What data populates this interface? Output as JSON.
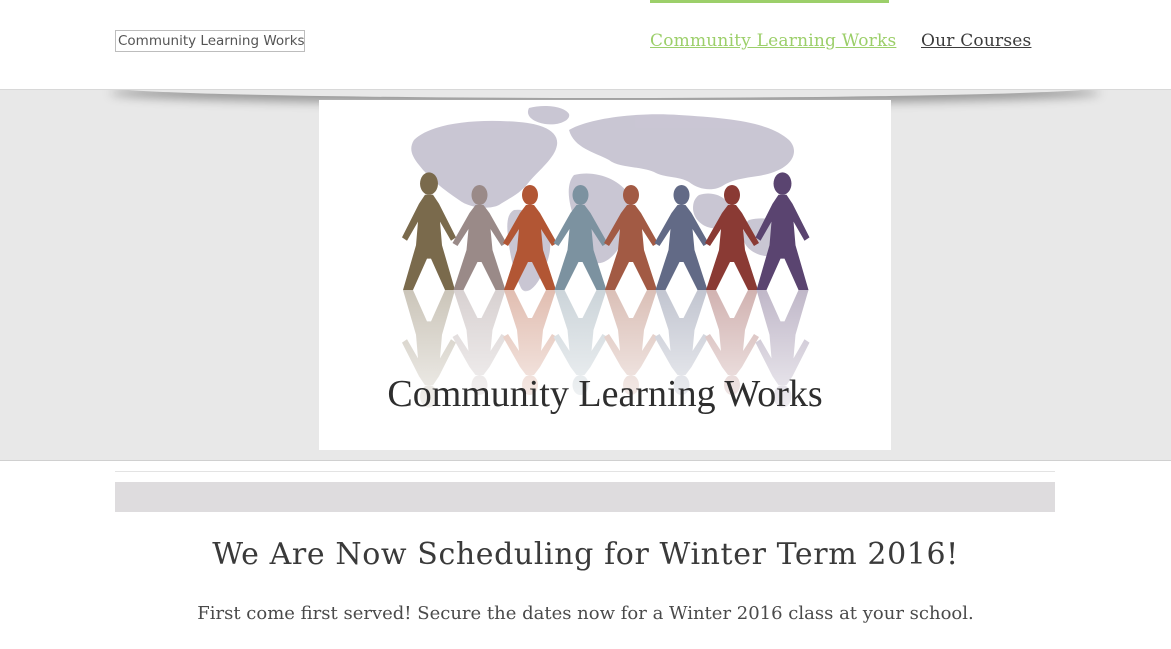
{
  "header": {
    "logo_text": "Community Learning Works",
    "nav": [
      {
        "label": "Community Learning Works",
        "active": true
      },
      {
        "label": "Our Courses",
        "active": false
      }
    ]
  },
  "banner": {
    "image_caption": "Community Learning Works",
    "figure_colors": [
      "#7a6a4c",
      "#9a8a88",
      "#b25634",
      "#7c92a0",
      "#a25a44",
      "#626a86",
      "#8a3a34",
      "#5a4470"
    ]
  },
  "main": {
    "headline": "We Are Now Scheduling for Winter Term 2016!",
    "subtext": "First come first served! Secure the dates now for a Winter 2016 class at your school."
  },
  "colors": {
    "accent": "#9ccf6a",
    "banner_bg": "#e8e8e8",
    "bar_gray": "#dedcde"
  }
}
